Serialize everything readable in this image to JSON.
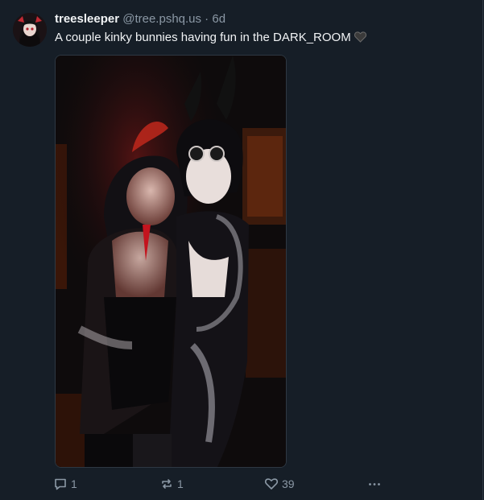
{
  "post": {
    "author": "treesleeper",
    "handle": "@tree.pshq.us",
    "separator": " · ",
    "time": "6d",
    "text": "A couple kinky bunnies having fun in the DARK_ROOM",
    "emoji": "black-heart-icon"
  },
  "actions": {
    "reply_count": "1",
    "repost_count": "1",
    "like_count": "39",
    "more_icon": "ellipsis-icon"
  },
  "colors": {
    "background": "#161e27",
    "text": "#f1f3f5",
    "muted": "#8b98a5",
    "border": "#2e3843"
  }
}
